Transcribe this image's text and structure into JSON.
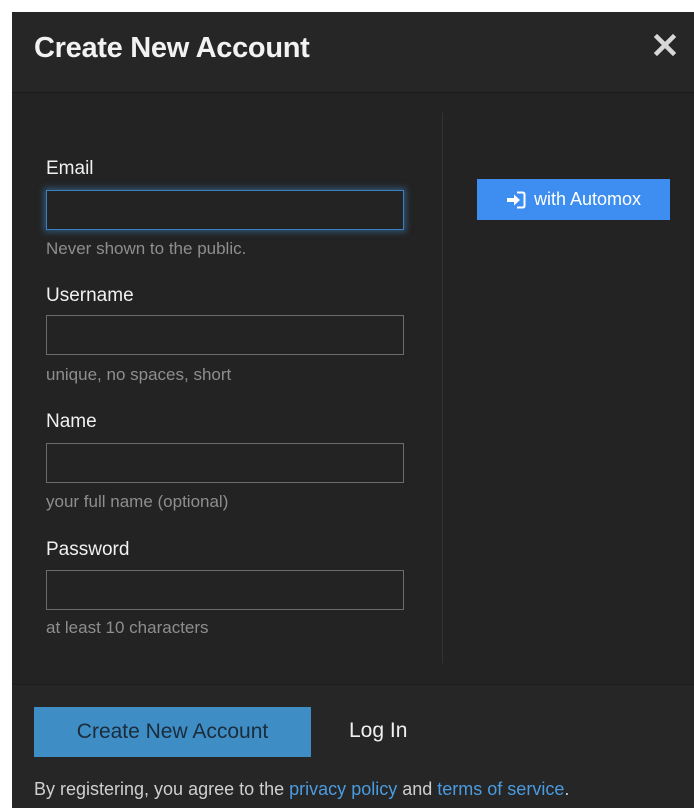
{
  "header": {
    "title": "Create New Account",
    "close_icon": "close-icon"
  },
  "form": {
    "email": {
      "label": "Email",
      "value": "",
      "placeholder": "",
      "hint": "Never shown to the public."
    },
    "username": {
      "label": "Username",
      "value": "",
      "placeholder": "",
      "hint": "unique, no spaces, short"
    },
    "name": {
      "label": "Name",
      "value": "",
      "placeholder": "",
      "hint": "your full name (optional)"
    },
    "password": {
      "label": "Password",
      "value": "",
      "placeholder": "",
      "hint": "at least 10 characters"
    }
  },
  "oauth": {
    "label": "with Automox",
    "icon": "sign-in-icon"
  },
  "footer": {
    "create_label": "Create New Account",
    "login_label": "Log In",
    "terms_prefix": "By registering, you agree to the",
    "privacy_label": "privacy policy",
    "terms_and": "and",
    "tos_label": "terms of service",
    "terms_suffix": "."
  },
  "colors": {
    "modal_bg": "#232323",
    "accent": "#3d8ef0",
    "primary_button": "#3f8dc5",
    "link": "#4a9be0",
    "focus_ring": "#3a7fc0"
  }
}
